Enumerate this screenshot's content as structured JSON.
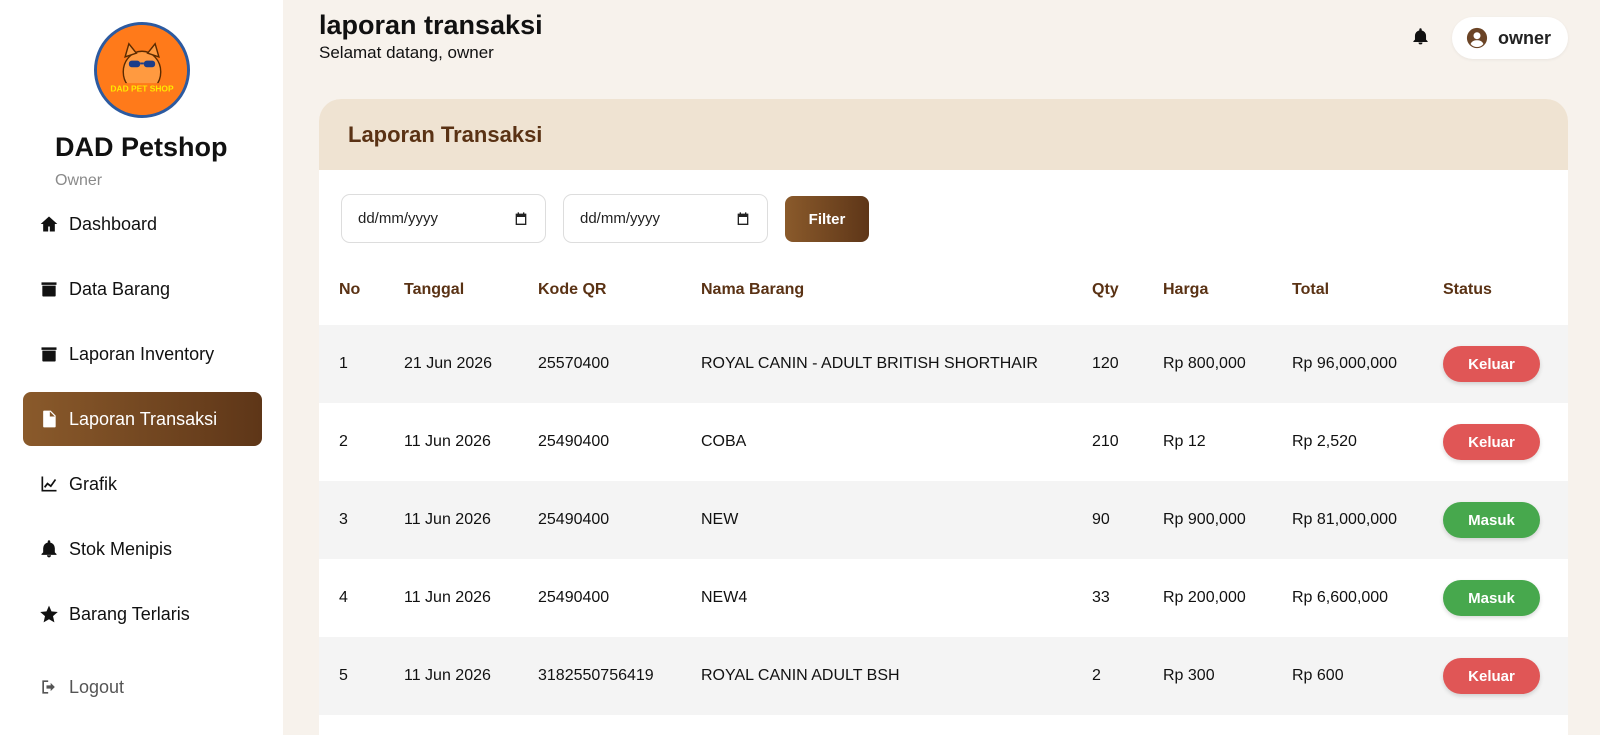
{
  "sidebar": {
    "brand_title": "DAD Petshop",
    "brand_sub": "Owner",
    "logo_text": "DAD PET SHOP",
    "items": [
      {
        "label": "Dashboard",
        "icon": "home-icon"
      },
      {
        "label": "Data Barang",
        "icon": "box-icon"
      },
      {
        "label": "Laporan Inventory",
        "icon": "box-icon"
      },
      {
        "label": "Laporan Transaksi",
        "icon": "file-icon",
        "active": true
      },
      {
        "label": "Grafik",
        "icon": "chart-line-icon"
      },
      {
        "label": "Stok Menipis",
        "icon": "bell-icon"
      },
      {
        "label": "Barang Terlaris",
        "icon": "star-icon"
      }
    ],
    "logout": "Logout"
  },
  "header": {
    "title": "laporan transaksi",
    "subtitle": "Selamat datang, owner",
    "user": "owner"
  },
  "card": {
    "title": "Laporan Transaksi",
    "date_from_placeholder": "dd/mm/yyyy",
    "date_to_placeholder": "dd/mm/yyyy",
    "filter_label": "Filter"
  },
  "table": {
    "columns": [
      "No",
      "Tanggal",
      "Kode QR",
      "Nama Barang",
      "Qty",
      "Harga",
      "Total",
      "Status"
    ],
    "rows": [
      {
        "no": "1",
        "tanggal": "21 Jun 2026",
        "kode": "25570400",
        "nama": "ROYAL CANIN - ADULT BRITISH SHORTHAIR",
        "qty": "120",
        "harga": "Rp 800,000",
        "total": "Rp 96,000,000",
        "status": "Keluar"
      },
      {
        "no": "2",
        "tanggal": "11 Jun 2026",
        "kode": "25490400",
        "nama": "COBA",
        "qty": "210",
        "harga": "Rp 12",
        "total": "Rp 2,520",
        "status": "Keluar"
      },
      {
        "no": "3",
        "tanggal": "11 Jun 2026",
        "kode": "25490400",
        "nama": "NEW",
        "qty": "90",
        "harga": "Rp 900,000",
        "total": "Rp 81,000,000",
        "status": "Masuk"
      },
      {
        "no": "4",
        "tanggal": "11 Jun 2026",
        "kode": "25490400",
        "nama": "NEW4",
        "qty": "33",
        "harga": "Rp 200,000",
        "total": "Rp 6,600,000",
        "status": "Masuk"
      },
      {
        "no": "5",
        "tanggal": "11 Jun 2026",
        "kode": "3182550756419",
        "nama": "ROYAL CANIN ADULT BSH",
        "qty": "2",
        "harga": "Rp 300",
        "total": "Rp 600",
        "status": "Keluar"
      }
    ]
  },
  "colors": {
    "accent_dark": "#5e3618",
    "accent_light": "#8a5a2b",
    "header_bg": "#efe3d2",
    "keluar": "#e05656",
    "masuk": "#47a84d"
  }
}
